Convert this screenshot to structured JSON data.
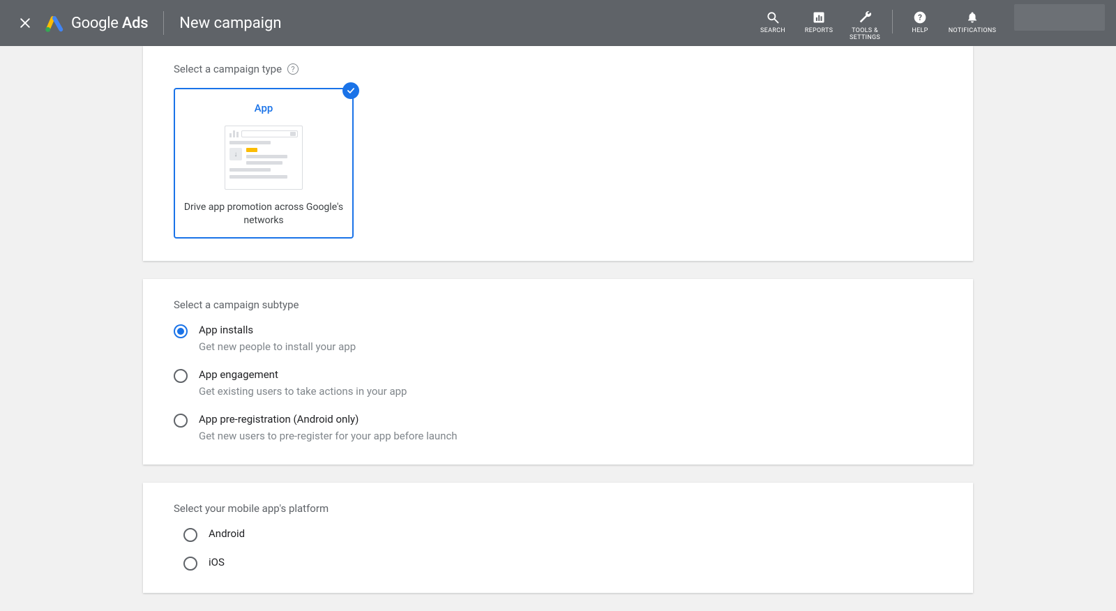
{
  "header": {
    "brand_html": "Google <b>Ads</b>",
    "brand_text": "Google Ads",
    "page_title": "New campaign",
    "tools": [
      {
        "icon": "search",
        "label": "SEARCH"
      },
      {
        "icon": "reports",
        "label": "REPORTS"
      },
      {
        "icon": "tools",
        "label": "TOOLS &\nSETTINGS"
      },
      {
        "icon": "help",
        "label": "HELP"
      },
      {
        "icon": "notifications",
        "label": "NOTIFICATIONS"
      }
    ]
  },
  "sections": {
    "campaign_type": {
      "label": "Select a campaign type",
      "option": {
        "title": "App",
        "description": "Drive app promotion across Google's networks",
        "selected": true
      }
    },
    "subtype": {
      "label": "Select a campaign subtype",
      "options": [
        {
          "title": "App installs",
          "desc": "Get new people to install your app",
          "selected": true
        },
        {
          "title": "App engagement",
          "desc": "Get existing users to take actions in your app",
          "selected": false
        },
        {
          "title": "App pre-registration (Android only)",
          "desc": "Get new users to pre-register for your app before launch",
          "selected": false
        }
      ]
    },
    "platform": {
      "label": "Select your mobile app's platform",
      "options": [
        {
          "title": "Android",
          "selected": false
        },
        {
          "title": "iOS",
          "selected": false
        }
      ]
    }
  }
}
